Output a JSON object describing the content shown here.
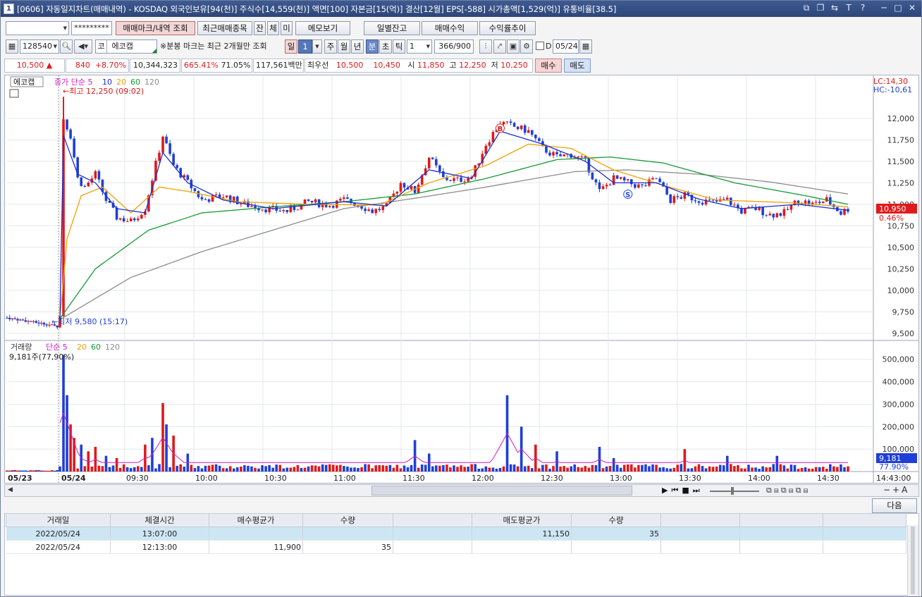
{
  "title": {
    "window_number": "1",
    "text": "[0606] 자동일지차트(매매내역) - KOSDAQ 외국인보유[94(천)] 주식수[14,559(천)] 액면[100] 자본금[15(억)] 결산[12월] EPS[-588] 시가총액[1,529(억)] 유통비율[38.5]",
    "icons": [
      "restore-icon",
      "new-window-icon",
      "link-icon",
      "font-size-icon",
      "help-icon",
      "minimize-icon",
      "maximize-icon",
      "close-icon"
    ],
    "icon_glyphs": [
      "⧉",
      "❐",
      "⇆",
      "T",
      "?",
      "─",
      "□",
      "✕"
    ]
  },
  "toolbar1": {
    "account_value": "",
    "password_value": "*********",
    "buttons": [
      "매매마크/내역 조회",
      "최근매매종목",
      "잔",
      "체",
      "미",
      "메모보기"
    ],
    "right_buttons": [
      "일별잔고",
      "매매수익",
      "수익률추이"
    ]
  },
  "toolbar2": {
    "code": "128540",
    "market_prefix": "코",
    "stock_name": "에코캡",
    "notice": "※분봉 마크는 최근 2개월만 조회",
    "period_label": "일",
    "period_value": "1",
    "periods": [
      "주",
      "월",
      "년",
      "분",
      "초",
      "틱"
    ],
    "interval": "1",
    "count": "366/900",
    "checkbox_label": "D",
    "date": "05/24"
  },
  "quote": {
    "price": "10,500",
    "change_arrow": "▲",
    "change": "840",
    "change_pct": "+8.70%",
    "volume": "10,344,323",
    "volume_ratio": "665.41%",
    "turnover": "71.05%",
    "amount": "117,561백만",
    "priority_label": "최우선",
    "ask": "10,500",
    "bid": "10,450",
    "open_label": "시",
    "open": "11,850",
    "high_label": "고",
    "high": "12,250",
    "low_label": "저",
    "low": "10,250",
    "buy_btn": "매수",
    "sell_btn": "매도"
  },
  "chart_data": {
    "type": "candlestick",
    "stock": "에코캡",
    "price_legend": {
      "name": "종가",
      "method": "단순",
      "periods": [
        "5",
        "10",
        "20",
        "60",
        "120"
      ],
      "colors": [
        "#1a2fd0",
        "#f0a000",
        "#159a35",
        "#8c8c8c"
      ]
    },
    "lc": "LC:14,30",
    "hc": "HC:-10,61",
    "high_annot": "←최고 12,250 (09:02)",
    "low_annot": "←최저 9,580 (15:17)",
    "y_ticks": [
      "12,000",
      "11,750",
      "11,500",
      "11,250",
      "11,000",
      "10,750",
      "10,500",
      "10,250",
      "10,000",
      "9,750",
      "9,500"
    ],
    "y_range": [
      9450,
      12400
    ],
    "last_price_label": "10,950",
    "last_pct_label": "0.46%",
    "x_labels": [
      "05/23",
      "05/24",
      "09:30",
      "10:00",
      "10:30",
      "11:00",
      "11:30",
      "12:00",
      "12:30",
      "13:00",
      "13:30",
      "14:00",
      "14:30",
      "14:43:00"
    ],
    "price_path": [
      [
        0,
        9680
      ],
      [
        4,
        9660
      ],
      [
        8,
        9640
      ],
      [
        12,
        9620
      ],
      [
        16,
        9600
      ],
      [
        19,
        9580
      ],
      [
        20,
        9700
      ],
      [
        21,
        12000
      ],
      [
        23,
        11800
      ],
      [
        25,
        11300
      ],
      [
        27,
        11200
      ],
      [
        30,
        11350
      ],
      [
        33,
        11050
      ],
      [
        36,
        10850
      ],
      [
        40,
        10800
      ],
      [
        44,
        10950
      ],
      [
        46,
        11300
      ],
      [
        49,
        11800
      ],
      [
        52,
        11450
      ],
      [
        56,
        11250
      ],
      [
        60,
        11050
      ],
      [
        66,
        11100
      ],
      [
        72,
        11000
      ],
      [
        78,
        10950
      ],
      [
        84,
        10920
      ],
      [
        90,
        11030
      ],
      [
        96,
        10990
      ],
      [
        100,
        11050
      ],
      [
        104,
        11000
      ],
      [
        108,
        10920
      ],
      [
        112,
        10970
      ],
      [
        116,
        11250
      ],
      [
        120,
        11150
      ],
      [
        124,
        11550
      ],
      [
        128,
        11300
      ],
      [
        132,
        11280
      ],
      [
        136,
        11320
      ],
      [
        140,
        11700
      ],
      [
        144,
        11950
      ],
      [
        148,
        11900
      ],
      [
        152,
        11850
      ],
      [
        156,
        11650
      ],
      [
        160,
        11550
      ],
      [
        164,
        11580
      ],
      [
        168,
        11500
      ],
      [
        172,
        11150
      ],
      [
        176,
        11300
      ],
      [
        180,
        11250
      ],
      [
        184,
        11200
      ],
      [
        188,
        11300
      ],
      [
        192,
        11050
      ],
      [
        196,
        11100
      ],
      [
        200,
        11050
      ],
      [
        204,
        11020
      ],
      [
        208,
        11050
      ],
      [
        212,
        10920
      ],
      [
        216,
        10950
      ],
      [
        220,
        10880
      ],
      [
        224,
        10900
      ],
      [
        228,
        11050
      ],
      [
        232,
        11000
      ],
      [
        236,
        11050
      ],
      [
        240,
        10900
      ],
      [
        242,
        10950
      ]
    ],
    "ma5": [
      [
        20,
        9650
      ],
      [
        21,
        11800
      ],
      [
        25,
        11350
      ],
      [
        30,
        11250
      ],
      [
        36,
        10950
      ],
      [
        44,
        10900
      ],
      [
        49,
        11600
      ],
      [
        56,
        11250
      ],
      [
        66,
        11050
      ],
      [
        80,
        10950
      ],
      [
        100,
        11030
      ],
      [
        112,
        10980
      ],
      [
        124,
        11400
      ],
      [
        136,
        11300
      ],
      [
        144,
        11850
      ],
      [
        156,
        11700
      ],
      [
        168,
        11500
      ],
      [
        176,
        11250
      ],
      [
        188,
        11250
      ],
      [
        200,
        11060
      ],
      [
        212,
        10950
      ],
      [
        228,
        11000
      ],
      [
        242,
        10930
      ]
    ],
    "ma20": [
      [
        20,
        9660
      ],
      [
        22,
        10600
      ],
      [
        26,
        11100
      ],
      [
        32,
        11200
      ],
      [
        40,
        10900
      ],
      [
        48,
        11200
      ],
      [
        56,
        11150
      ],
      [
        70,
        11030
      ],
      [
        90,
        11000
      ],
      [
        110,
        10990
      ],
      [
        124,
        11250
      ],
      [
        140,
        11450
      ],
      [
        152,
        11700
      ],
      [
        164,
        11650
      ],
      [
        176,
        11400
      ],
      [
        190,
        11220
      ],
      [
        205,
        11050
      ],
      [
        225,
        11020
      ],
      [
        242,
        10970
      ]
    ],
    "ma60": [
      [
        20,
        9670
      ],
      [
        30,
        10250
      ],
      [
        45,
        10700
      ],
      [
        60,
        10900
      ],
      [
        80,
        10970
      ],
      [
        100,
        11030
      ],
      [
        120,
        11120
      ],
      [
        140,
        11300
      ],
      [
        160,
        11520
      ],
      [
        175,
        11550
      ],
      [
        190,
        11480
      ],
      [
        210,
        11250
      ],
      [
        230,
        11100
      ],
      [
        242,
        11000
      ]
    ],
    "ma120": [
      [
        20,
        9660
      ],
      [
        40,
        10150
      ],
      [
        60,
        10450
      ],
      [
        80,
        10700
      ],
      [
        100,
        10950
      ],
      [
        120,
        11070
      ],
      [
        140,
        11200
      ],
      [
        165,
        11380
      ],
      [
        180,
        11400
      ],
      [
        200,
        11350
      ],
      [
        220,
        11260
      ],
      [
        242,
        11120
      ]
    ],
    "volume_legend": {
      "name": "거래량",
      "method": "단순",
      "periods": [
        "5",
        "20",
        "60",
        "120"
      ]
    },
    "volume_last": "9,181주(77,90%)",
    "volume_ticks": [
      "500,000",
      "400,000",
      "300,000",
      "200,000",
      "100,000"
    ],
    "volume_range": [
      0,
      540000
    ],
    "volume_last_label": "9,181",
    "volume_last_pct": "77.90%",
    "volume_spikes": [
      [
        21,
        520000
      ],
      [
        22,
        340000
      ],
      [
        23,
        210000
      ],
      [
        24,
        150000
      ],
      [
        26,
        120000
      ],
      [
        28,
        90000
      ],
      [
        30,
        110000
      ],
      [
        33,
        70000
      ],
      [
        36,
        60000
      ],
      [
        44,
        120000
      ],
      [
        46,
        150000
      ],
      [
        49,
        305000
      ],
      [
        50,
        210000
      ],
      [
        52,
        160000
      ],
      [
        56,
        80000
      ],
      [
        120,
        140000
      ],
      [
        124,
        80000
      ],
      [
        146,
        340000
      ],
      [
        150,
        200000
      ],
      [
        154,
        120000
      ],
      [
        160,
        90000
      ],
      [
        172,
        110000
      ],
      [
        176,
        60000
      ],
      [
        196,
        100000
      ],
      [
        208,
        70000
      ],
      [
        222,
        70000
      ]
    ]
  },
  "trades_table": {
    "columns": [
      "거래일",
      "체결시간",
      "매수평균가",
      "수량",
      "",
      "매도평균가",
      "수량",
      "",
      "",
      ""
    ],
    "rows": [
      [
        "2022/05/24",
        "13:07:00",
        "",
        "",
        "",
        "11,150",
        "35",
        "",
        "",
        ""
      ],
      [
        "2022/05/24",
        "12:13:00",
        "11,900",
        "35",
        "",
        "",
        "",
        "",
        "",
        ""
      ]
    ],
    "next_label": "다음"
  }
}
